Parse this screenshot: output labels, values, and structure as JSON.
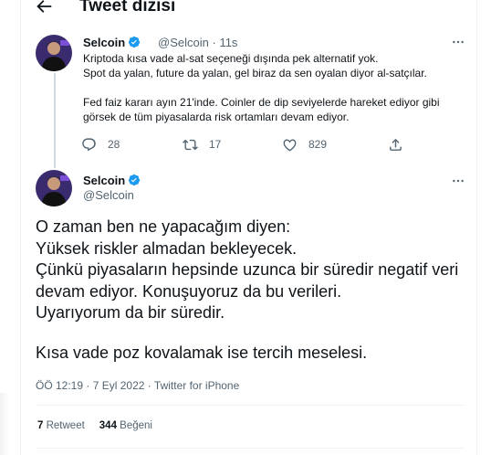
{
  "header": {
    "title": "Tweet dizisi",
    "back_icon": "arrow-left-icon"
  },
  "colors": {
    "accent": "#1d9bf0",
    "secondary_text": "#536471",
    "border": "#eff3f4"
  },
  "reply_tweet": {
    "name": "Selcoin",
    "handle": "@Selcoin",
    "separator": "·",
    "time": "11s",
    "lines": [
      "Kriptoda kısa vade al-sat seçeneği dışında pek alternatif yok.",
      "Spot da yalan, future da yalan, gel biraz da sen oyalan diyor al-satçılar.",
      "Fed faiz kararı ayın 21'inde. Coinler de dip seviyelerde hareket ediyor gibi görsek de tüm piyasalarda risk ortamları devam ediyor."
    ],
    "replies": "28",
    "retweets": "17",
    "likes": "829"
  },
  "main_tweet": {
    "name": "Selcoin",
    "handle": "@Selcoin",
    "lines": [
      "O zaman ben ne yapacağım diyen:",
      "Yüksek riskler almadan bekleyecek.",
      "Çünkü piyasaların hepsinde uzunca bir süredir negatif veri devam ediyor. Konuşuyoruz da bu verileri.",
      "Uyarıyorum da bir süredir.",
      "Kısa vade poz kovalamak ise tercih meselesi."
    ],
    "time": "ÖÖ 12:19",
    "separator": "·",
    "date": "7 Eyl 2022",
    "source": "Twitter for iPhone",
    "retweet_count": "7",
    "retweet_label": "Retweet",
    "like_count": "344",
    "like_label": "Beğeni"
  }
}
